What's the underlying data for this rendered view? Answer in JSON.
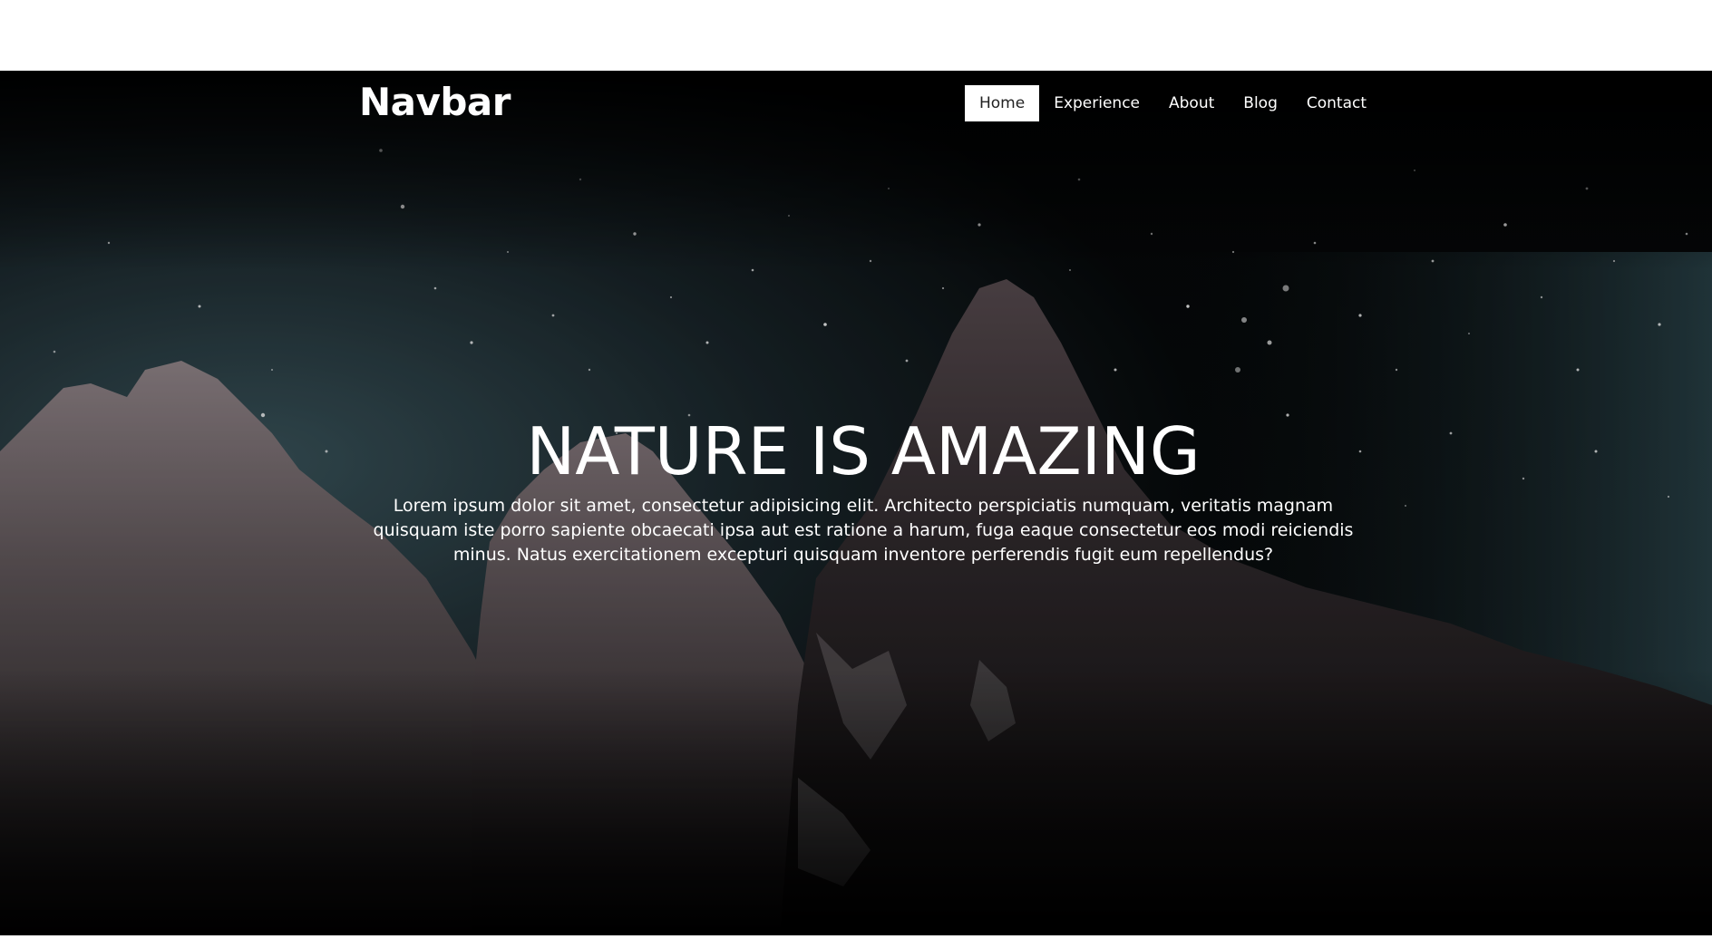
{
  "navbar": {
    "brand": "Navbar",
    "items": [
      {
        "label": "Home",
        "active": true
      },
      {
        "label": "Experience",
        "active": false
      },
      {
        "label": "About",
        "active": false
      },
      {
        "label": "Blog",
        "active": false
      },
      {
        "label": "Contact",
        "active": false
      }
    ]
  },
  "hero": {
    "title": "NATURE IS AMAZING",
    "text": "Lorem ipsum dolor sit amet, consectetur adipisicing elit. Architecto perspiciatis numquam, veritatis magnam quisquam iste porro sapiente obcaecati ipsa aut est ratione a harum, fuga eaque consectetur eos modi reiciendis minus. Natus exercitationem excepturi quisquam inventore perferendis fugit eum repellendus?",
    "background": "night-sky-mountain-image"
  },
  "colors": {
    "hero_overlay": "#000000",
    "text": "#ffffff",
    "active_nav_bg": "#ffffff",
    "active_nav_text": "#222222"
  }
}
